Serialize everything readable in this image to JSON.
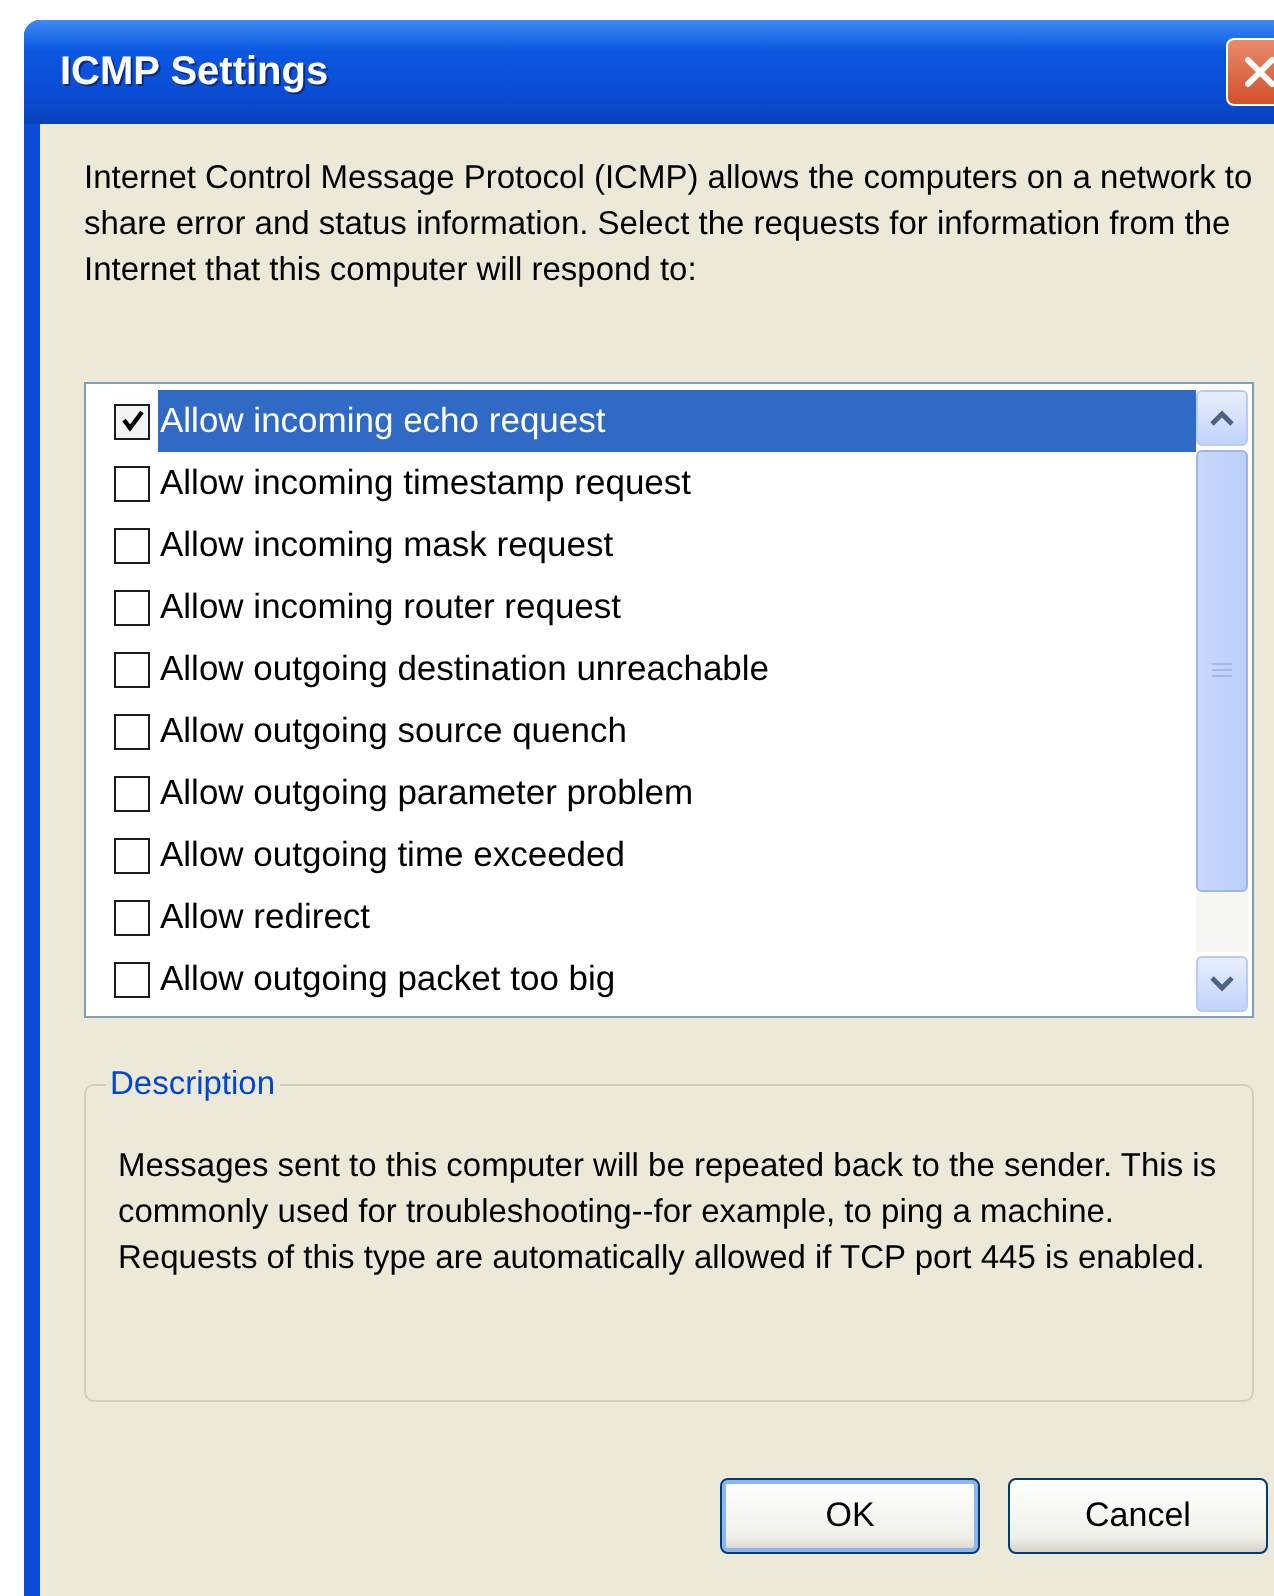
{
  "window": {
    "title": "ICMP Settings"
  },
  "intro": "Internet Control Message Protocol (ICMP) allows the computers on a network to share error and status information. Select the requests for information from the Internet that this computer will respond to:",
  "requests": [
    {
      "label": "Allow incoming echo request",
      "checked": true,
      "selected": true
    },
    {
      "label": "Allow incoming timestamp request",
      "checked": false,
      "selected": false
    },
    {
      "label": "Allow incoming mask request",
      "checked": false,
      "selected": false
    },
    {
      "label": "Allow incoming router request",
      "checked": false,
      "selected": false
    },
    {
      "label": "Allow outgoing destination unreachable",
      "checked": false,
      "selected": false
    },
    {
      "label": "Allow outgoing source quench",
      "checked": false,
      "selected": false
    },
    {
      "label": "Allow outgoing parameter problem",
      "checked": false,
      "selected": false
    },
    {
      "label": "Allow outgoing time exceeded",
      "checked": false,
      "selected": false
    },
    {
      "label": "Allow redirect",
      "checked": false,
      "selected": false
    },
    {
      "label": "Allow outgoing packet too big",
      "checked": false,
      "selected": false
    }
  ],
  "description": {
    "title": "Description",
    "text": "Messages sent to this computer will be repeated back to the sender. This is commonly used for troubleshooting--for example, to ping a machine. Requests of this type are automatically allowed if TCP port 445 is enabled."
  },
  "buttons": [
    "OK",
    "Cancel"
  ]
}
